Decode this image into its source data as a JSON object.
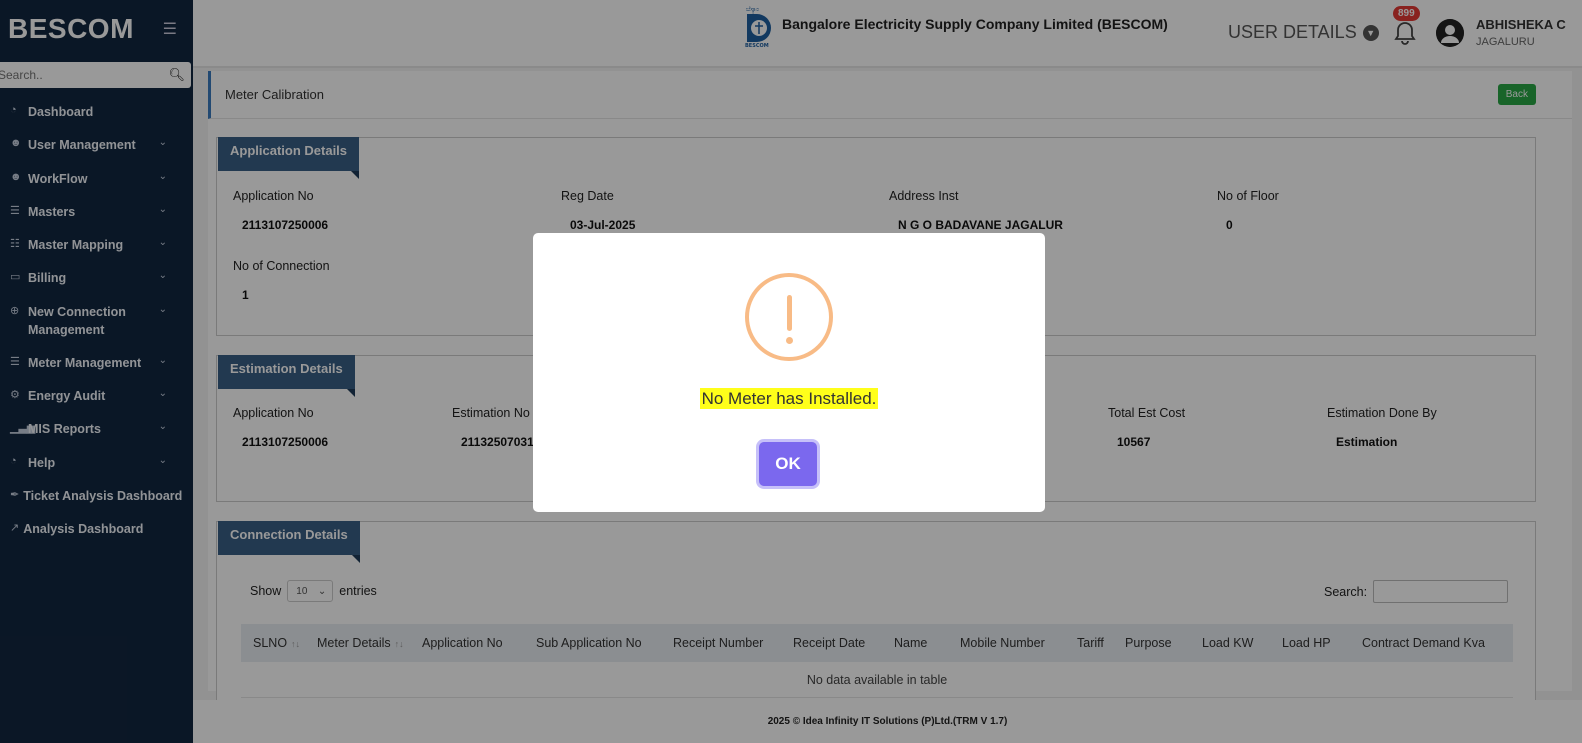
{
  "sidebar": {
    "brand": "BESCOM",
    "search_placeholder": "Search..",
    "items": [
      {
        "label": "Dashboard",
        "icon": "dashboard-icon",
        "chevron": false
      },
      {
        "label": "User Management",
        "icon": "user-icon",
        "chevron": true
      },
      {
        "label": "WorkFlow",
        "icon": "user-icon",
        "chevron": true
      },
      {
        "label": "Masters",
        "icon": "list-icon",
        "chevron": true
      },
      {
        "label": "Master Mapping",
        "icon": "sitemap-icon",
        "chevron": true
      },
      {
        "label": "Billing",
        "icon": "monitor-icon",
        "chevron": true
      },
      {
        "label": "New Connection Management",
        "icon": "plus-circle-icon",
        "chevron": true
      },
      {
        "label": "Meter Management",
        "icon": "list-icon",
        "chevron": true
      },
      {
        "label": "Energy Audit",
        "icon": "cogs-icon",
        "chevron": true
      },
      {
        "label": "MIS Reports",
        "icon": "bar-chart-icon",
        "chevron": true
      },
      {
        "label": "Help",
        "icon": "dashboard-icon",
        "chevron": true
      },
      {
        "label": "Ticket Analysis Dashboard",
        "icon": "tag-icon",
        "chevron": false
      },
      {
        "label": "Analysis Dashboard",
        "icon": "line-chart-icon",
        "chevron": false
      }
    ]
  },
  "header": {
    "company": "Bangalore Electricity Supply Company Limited (BESCOM)",
    "user_details": "USER DETAILS",
    "notification_count": "899",
    "user_name": "ABHISHEKA C",
    "user_location": "JAGALURU"
  },
  "page": {
    "title": "Meter Calibration",
    "back_label": "Back"
  },
  "application": {
    "heading": "Application Details",
    "fields": {
      "app_no_label": "Application No",
      "app_no": "2113107250006",
      "reg_date_label": "Reg Date",
      "reg_date": "03-Jul-2025",
      "address_label": "Address Inst",
      "address": "N G O BADAVANE JAGALUR",
      "floor_label": "No of Floor",
      "floor": "0",
      "conn_label": "No of Connection",
      "conn": "1"
    }
  },
  "estimation": {
    "heading": "Estimation Details",
    "fields": {
      "app_no_label": "Application No",
      "app_no": "2113107250006",
      "est_no_label": "Estimation No",
      "est_no": "21132507031",
      "total_label": "Total Est Cost",
      "total": "10567",
      "done_by_label": "Estimation Done By",
      "done_by": "Estimation"
    }
  },
  "connection": {
    "heading": "Connection Details",
    "show_label": "Show",
    "entries_value": "10",
    "entries_label": "entries",
    "search_label": "Search:",
    "columns": [
      "SLNO",
      "Meter Details",
      "Application No",
      "Sub Application No",
      "Receipt Number",
      "Receipt Date",
      "Name",
      "Mobile Number",
      "Tariff",
      "Purpose",
      "Load KW",
      "Load HP",
      "Contract Demand Kva"
    ],
    "empty_text": "No data available in table"
  },
  "footer": {
    "text": "2025 © Idea Infinity IT Solutions (P)Ltd.(TRM V 1.7)"
  },
  "dialog": {
    "message": "No Meter has Installed.",
    "ok_label": "OK",
    "warning_color": "#f8bb86",
    "button_color": "#7b68ee"
  }
}
